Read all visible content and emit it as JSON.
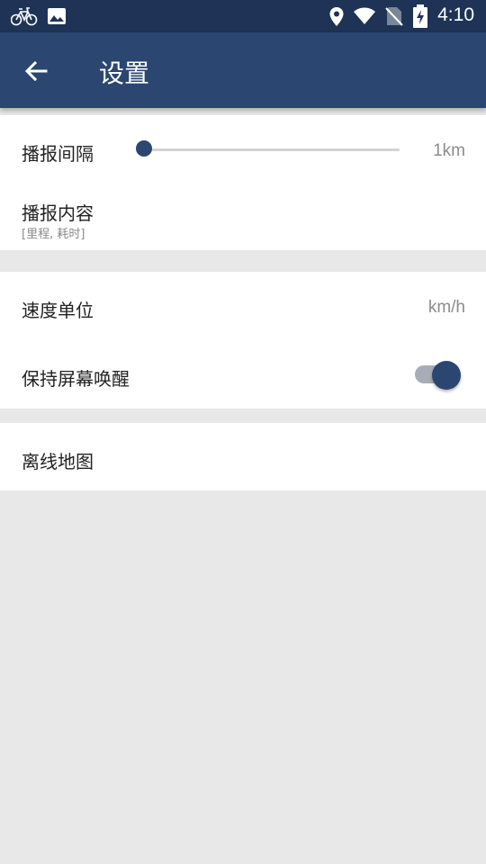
{
  "status_bar": {
    "time": "4:10",
    "icons": [
      "bicycle-icon",
      "image-icon",
      "location-icon",
      "wifi-icon",
      "no-sim-icon",
      "battery-charging-icon"
    ]
  },
  "app_bar": {
    "back_icon": "arrow-left-icon",
    "title": "设置"
  },
  "settings": {
    "broadcast_interval": {
      "label": "播报间隔",
      "value": "1km",
      "slider_fraction": 0.0
    },
    "broadcast_content": {
      "label": "播报内容",
      "summary": "[里程, 耗时]"
    },
    "speed_unit": {
      "label": "速度单位",
      "value": "km/h"
    },
    "keep_screen_awake": {
      "label": "保持屏幕唤醒",
      "enabled": true
    },
    "offline_map": {
      "label": "离线地图"
    }
  },
  "colors": {
    "status_bar": "#1e3356",
    "app_bar": "#2b4670",
    "accent": "#2b4670",
    "background": "#e8e8e8"
  }
}
